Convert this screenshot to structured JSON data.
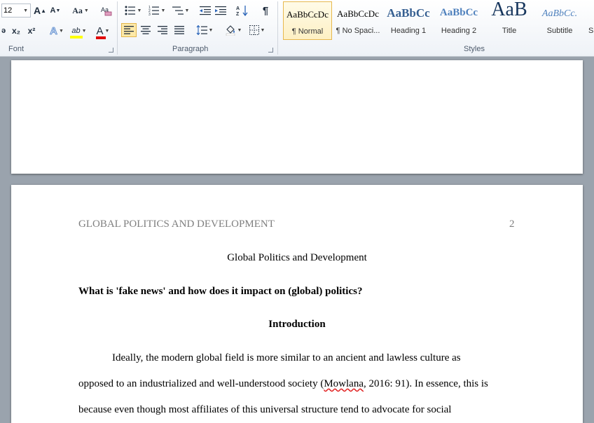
{
  "ribbon": {
    "font": {
      "size_value": "12",
      "grow_font_label": "A",
      "shrink_font_label": "A",
      "change_case_label": "Aa",
      "subscript_label": "x₂",
      "superscript_label": "x²",
      "text_effects_label": "A",
      "highlight_label": "ab",
      "font_color_label": "A",
      "group_label": "Font"
    },
    "paragraph": {
      "group_label": "Paragraph",
      "pilcrow_label": "¶"
    },
    "styles": {
      "group_label": "Styles",
      "items": [
        {
          "sample": "AaBbCcDc",
          "name": "¶ Normal"
        },
        {
          "sample": "AaBbCcDc",
          "name": "¶ No Spaci..."
        },
        {
          "sample": "AaBbCc",
          "name": "Heading 1"
        },
        {
          "sample": "AaBbCc",
          "name": "Heading 2"
        },
        {
          "sample": "AaB",
          "name": "Title"
        },
        {
          "sample": "AaBbCc.",
          "name": "Subtitle"
        },
        {
          "sample": "",
          "name": "S"
        }
      ]
    }
  },
  "document": {
    "header_text": "GLOBAL POLITICS AND DEVELOPMENT",
    "page_number": "2",
    "title": "Global Politics and Development",
    "question": "What is 'fake news' and how does it impact on (global) politics?",
    "section_heading": "Introduction",
    "para_line1": "Ideally, the modern global field is more similar to an ancient and lawless culture as",
    "para_line2_before": "opposed to an industrialized and well-understood society (",
    "para_line2_cite": "Mowlana",
    "para_line2_after": ", 2016: 91). In essence, this is",
    "para_line3": "because even though most affiliates of this universal structure tend to advocate for social"
  },
  "colors": {
    "accent_selected_style": "#fdf0c4",
    "heading_blue": "#365f91",
    "header_gray": "#7f7f7f"
  }
}
